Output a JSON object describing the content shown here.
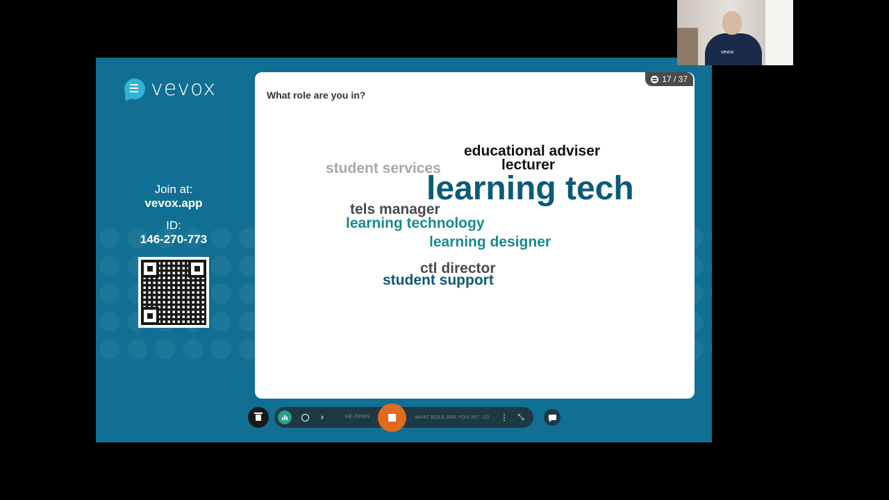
{
  "brand": {
    "logo_text": "vevox"
  },
  "join": {
    "join_label": "Join at:",
    "join_url": "vevox.app",
    "id_label": "ID:",
    "id_value": "146-270-773"
  },
  "poll": {
    "question": "What role are you in?",
    "response_count": "17 / 37",
    "words": [
      {
        "text": "educational adviser",
        "color": "#111111"
      },
      {
        "text": "lecturer",
        "color": "#111111"
      },
      {
        "text": "student services",
        "color": "#a8a8a8"
      },
      {
        "text": "learning tech",
        "color": "#0a5a78"
      },
      {
        "text": "tels manager",
        "color": "#4a4a4a"
      },
      {
        "text": "learning technology",
        "color": "#178a8f"
      },
      {
        "text": "learning designer",
        "color": "#178a8f"
      },
      {
        "text": "ctl director",
        "color": "#4a4a4a"
      },
      {
        "text": "student support",
        "color": "#0a5a78"
      }
    ]
  },
  "toolbar": {
    "reopen_label": "RE-OPEN",
    "question_label": "WHAT ROLE ARE YOU IN?",
    "question_index": "1/2",
    "more_glyph": "⋮",
    "next_glyph": "›"
  },
  "colors": {
    "background": "#106f92",
    "stop_button": "#e06a1e",
    "accent_teal": "#2a9d8f"
  },
  "webcam": {
    "shirt_text": "vevox"
  }
}
